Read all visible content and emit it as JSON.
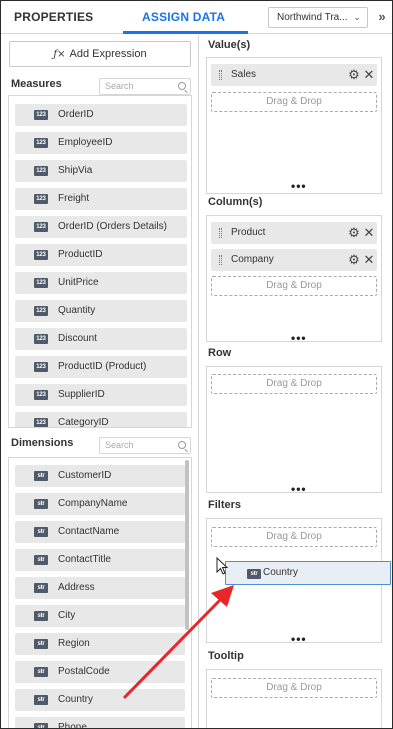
{
  "header": {
    "tab_properties": "PROPERTIES",
    "tab_assign_data": "ASSIGN DATA",
    "datasource": "Northwind Tra...",
    "chevron": "⌄",
    "collapse": "»"
  },
  "left": {
    "add_expression": "Add Expression",
    "fx_symbol": "ƒ×",
    "measures_label": "Measures",
    "measures_search_placeholder": "Search",
    "measures": [
      {
        "badge": "123",
        "label": "OrderID"
      },
      {
        "badge": "123",
        "label": "EmployeeID"
      },
      {
        "badge": "123",
        "label": "ShipVia"
      },
      {
        "badge": "123",
        "label": "Freight"
      },
      {
        "badge": "123",
        "label": "OrderID (Orders Details)"
      },
      {
        "badge": "123",
        "label": "ProductID"
      },
      {
        "badge": "123",
        "label": "UnitPrice"
      },
      {
        "badge": "123",
        "label": "Quantity"
      },
      {
        "badge": "123",
        "label": "Discount"
      },
      {
        "badge": "123",
        "label": "ProductID (Product)"
      },
      {
        "badge": "123",
        "label": "SupplierID"
      },
      {
        "badge": "123",
        "label": "CategoryID"
      }
    ],
    "dimensions_label": "Dimensions",
    "dimensions_search_placeholder": "Search",
    "dimensions": [
      {
        "badge": "str",
        "label": "CustomerID"
      },
      {
        "badge": "str",
        "label": "CompanyName"
      },
      {
        "badge": "str",
        "label": "ContactName"
      },
      {
        "badge": "str",
        "label": "ContactTitle"
      },
      {
        "badge": "str",
        "label": "Address"
      },
      {
        "badge": "str",
        "label": "City"
      },
      {
        "badge": "str",
        "label": "Region"
      },
      {
        "badge": "str",
        "label": "PostalCode"
      },
      {
        "badge": "str",
        "label": "Country"
      },
      {
        "badge": "str",
        "label": "Phone"
      }
    ]
  },
  "right": {
    "values_title": "Value(s)",
    "values_items": [
      "Sales"
    ],
    "columns_title": "Column(s)",
    "columns_items": [
      "Product",
      "Company"
    ],
    "row_title": "Row",
    "filters_title": "Filters",
    "tooltip_title": "Tooltip",
    "drop_hint": "Drag & Drop",
    "more": "•••"
  },
  "drag": {
    "badge": "str",
    "label": "Country"
  },
  "colors": {
    "accent": "#1a73e8",
    "badge": "#505a69",
    "arrow": "#e8262b",
    "ghost_border": "#4a90d9"
  }
}
